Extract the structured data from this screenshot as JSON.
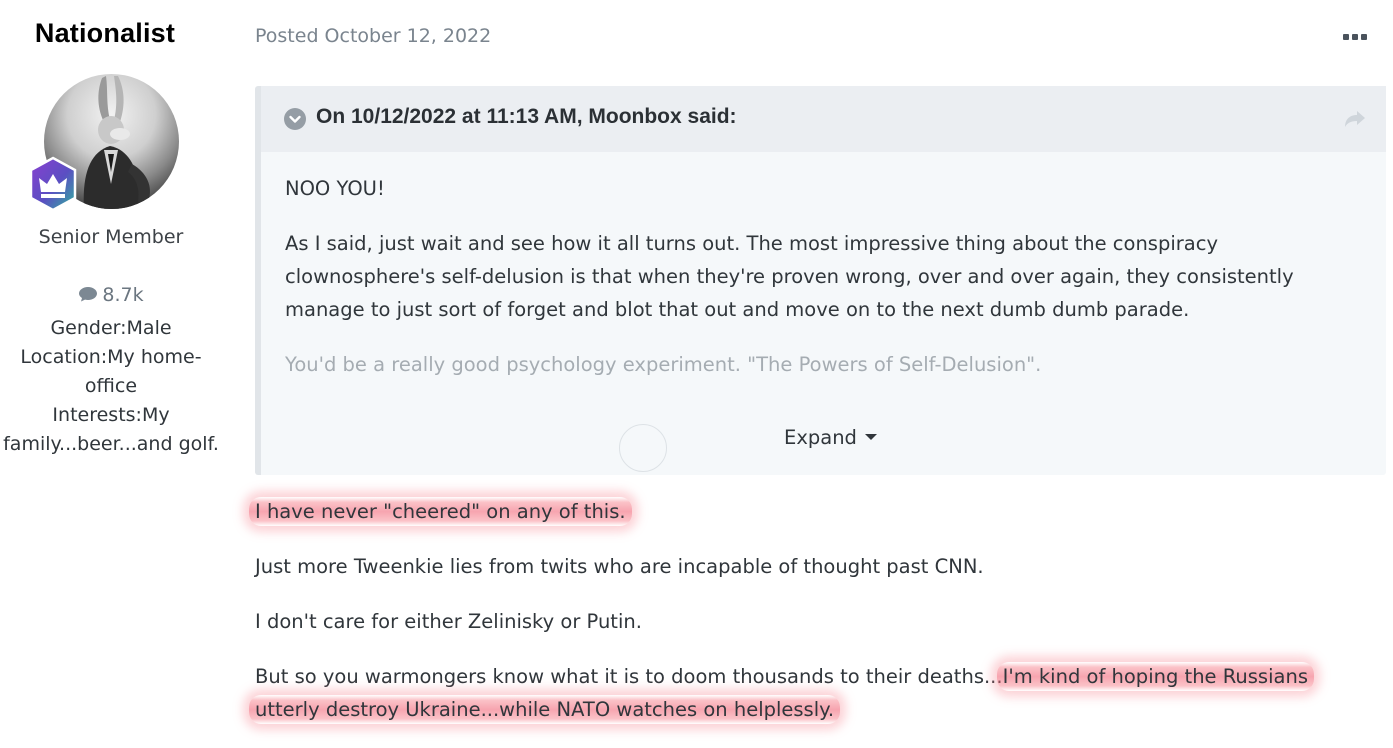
{
  "author": {
    "name": "Nationalist",
    "title": "Senior Member",
    "post_count": "8.7k",
    "fields": [
      "Gender:Male",
      "Location:My home-",
      "office",
      "Interests:My",
      "family...beer...and golf."
    ]
  },
  "post": {
    "posted_label": "Posted October 12, 2022",
    "quote": {
      "citation": "On 10/12/2022 at 11:13 AM, Moonbox said:",
      "p1": "NOO YOU!",
      "p2_line1": "As I said, just wait and see how it all turns out.  The most impressive thing about the conspiracy",
      "p2_line2": "clownosphere's self-delusion is that when they're proven wrong, over and over again, they consistently",
      "p2_line3": "manage to just sort of forget and blot that out and move on to the next dumb dumb parade.",
      "p3": "You'd be a really good psychology experiment.  \"The Powers of Self-Delusion\".",
      "expand_label": "Expand"
    },
    "body": {
      "line1": "I have never \"cheered\" on any of this.",
      "line2": "Just more Tweenkie lies from twits who are incapable of thought past CNN.",
      "line3": "I don't care for either Zelinisky or Putin.",
      "line4_plain": "But so you warmongers know what it is to doom thousands to their deaths...",
      "line4_highlight": "I'm kind of hoping the Russians",
      "line5_highlight": "utterly destroy Ukraine...while NATO watches on helplessly."
    }
  },
  "icons": {
    "more": "ellipsis-icon",
    "share": "share-icon",
    "toggle": "chevron-down-icon",
    "posts": "speech-bubble-icon",
    "rank": "crown-badge-icon"
  },
  "colors": {
    "highlight": "#f06e7e",
    "quote_bg": "#f5f8fa",
    "quote_head_bg": "#ebeef2",
    "badge": "#6b4fc8"
  }
}
